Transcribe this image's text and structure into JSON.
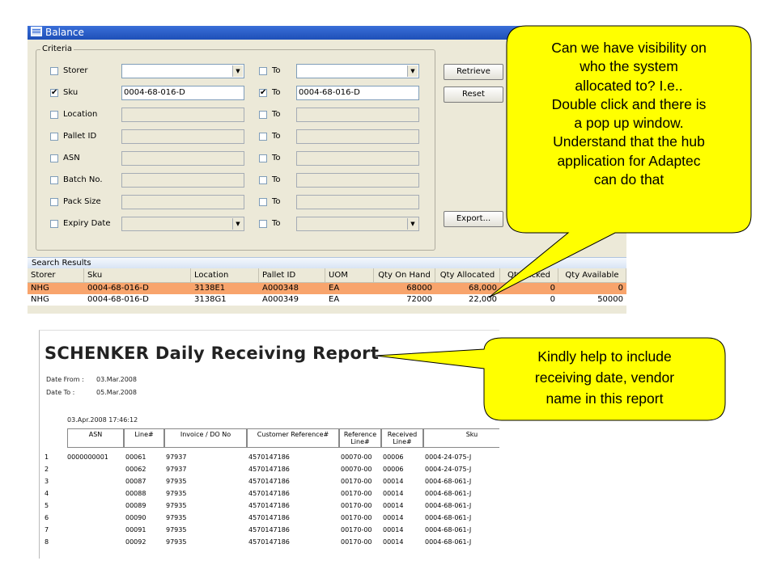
{
  "window": {
    "title": "Balance"
  },
  "criteria": {
    "label": "Criteria",
    "to_label": "To",
    "rows": [
      {
        "label": "Storer",
        "checked": false,
        "from_value": "",
        "to_checked": false,
        "to_value": "",
        "dropdown": true,
        "enabled": true
      },
      {
        "label": "Sku",
        "checked": true,
        "from_value": "0004-68-016-D",
        "to_checked": true,
        "to_value": "0004-68-016-D",
        "dropdown": false,
        "enabled": true
      },
      {
        "label": "Location",
        "checked": false,
        "from_value": "",
        "to_checked": false,
        "to_value": "",
        "dropdown": false,
        "enabled": false
      },
      {
        "label": "Pallet ID",
        "checked": false,
        "from_value": "",
        "to_checked": false,
        "to_value": "",
        "dropdown": false,
        "enabled": false
      },
      {
        "label": "ASN",
        "checked": false,
        "from_value": "",
        "to_checked": false,
        "to_value": "",
        "dropdown": false,
        "enabled": false
      },
      {
        "label": "Batch No.",
        "checked": false,
        "from_value": "",
        "to_checked": false,
        "to_value": "",
        "dropdown": false,
        "enabled": false
      },
      {
        "label": "Pack Size",
        "checked": false,
        "from_value": "",
        "to_checked": false,
        "to_value": "",
        "dropdown": false,
        "enabled": false
      },
      {
        "label": "Expiry Date",
        "checked": false,
        "from_value": "",
        "to_checked": false,
        "to_value": "",
        "dropdown": true,
        "enabled": false
      }
    ]
  },
  "buttons": {
    "retrieve": "Retrieve",
    "reset": "Reset",
    "export": "Export..."
  },
  "results": {
    "title": "Search Results",
    "columns": [
      "Storer",
      "Sku",
      "Location",
      "Pallet ID",
      "UOM",
      "Qty On Hand",
      "Qty Allocated",
      "Qty Picked",
      "Qty Available"
    ],
    "rows": [
      [
        "NHG",
        "0004-68-016-D",
        "3138E1",
        "A000348",
        "EA",
        "68000",
        "68,000",
        "0",
        "0"
      ],
      [
        "NHG",
        "0004-68-016-D",
        "3138G1",
        "A000349",
        "EA",
        "72000",
        "22,000",
        "0",
        "50000"
      ]
    ]
  },
  "report": {
    "title": "SCHENKER Daily Receiving Report",
    "date_from_label": "Date From :",
    "date_from": "03.Mar.2008",
    "date_to_label": "Date To :",
    "date_to": "05.Mar.2008",
    "timestamp": "03.Apr.2008 17:46:12",
    "columns": [
      "ASN",
      "Line#",
      "Invoice / DO No",
      "Customer Reference#",
      "Reference Line#",
      "Received Line#",
      "Sku"
    ],
    "rows": [
      [
        "1",
        "0000000001",
        "00061",
        "97937",
        "4570147186",
        "00070-00",
        "00006",
        "0004-24-075-J"
      ],
      [
        "2",
        "",
        "00062",
        "97937",
        "4570147186",
        "00070-00",
        "00006",
        "0004-24-075-J"
      ],
      [
        "3",
        "",
        "00087",
        "97935",
        "4570147186",
        "00170-00",
        "00014",
        "0004-68-061-J"
      ],
      [
        "4",
        "",
        "00088",
        "97935",
        "4570147186",
        "00170-00",
        "00014",
        "0004-68-061-J"
      ],
      [
        "5",
        "",
        "00089",
        "97935",
        "4570147186",
        "00170-00",
        "00014",
        "0004-68-061-J"
      ],
      [
        "6",
        "",
        "00090",
        "97935",
        "4570147186",
        "00170-00",
        "00014",
        "0004-68-061-J"
      ],
      [
        "7",
        "",
        "00091",
        "97935",
        "4570147186",
        "00170-00",
        "00014",
        "0004-68-061-J"
      ],
      [
        "8",
        "",
        "00092",
        "97935",
        "4570147186",
        "00170-00",
        "00014",
        "0004-68-061-J"
      ]
    ]
  },
  "callouts": {
    "top": [
      "Can we have visibility on",
      "who the system",
      "allocated to?  I.e..",
      "Double click and there is",
      "a pop up window.",
      "Understand that the hub",
      "application for Adaptec",
      "can do that"
    ],
    "bottom": [
      "Kindly help to include",
      "receiving date, vendor",
      "name in this report"
    ]
  },
  "colors": {
    "titlebar": "#1e4fb8",
    "selected_row": "#f8a46c",
    "callout": "#ffff00"
  }
}
